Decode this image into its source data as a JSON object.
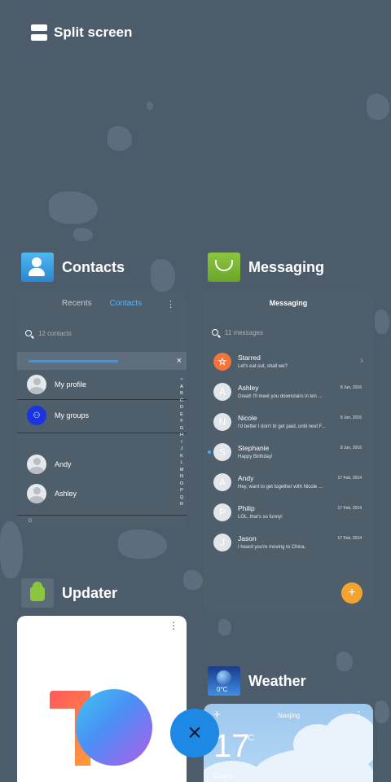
{
  "split": {
    "label": "Split screen"
  },
  "contacts": {
    "title": "Contacts",
    "tabs": [
      "Recents",
      "Contacts"
    ],
    "search_placeholder": "12 contacts",
    "rows": [
      "My profile",
      "My groups",
      "Andy",
      "Ashley"
    ],
    "section_letter": "D",
    "alphabet": [
      "♥",
      "A",
      "B",
      "C",
      "D",
      "E",
      "F",
      "G",
      "H",
      "I",
      "J",
      "K",
      "L",
      "M",
      "N",
      "O",
      "P",
      "Q",
      "R"
    ]
  },
  "messaging": {
    "title": "Messaging",
    "header": "Messaging",
    "search_placeholder": "11 messages",
    "rows": [
      {
        "initial": "☆",
        "name": "Starred",
        "preview": "Let's eat out, shall we?",
        "date": ""
      },
      {
        "initial": "A",
        "name": "Ashley",
        "preview": "Great! I'll meet you downstairs in ten ...",
        "date": "8 Jun, 2016"
      },
      {
        "initial": "N",
        "name": "Nicole",
        "preview": "I'd better I don't b! get paid, until next F...",
        "date": "8 Jun, 2016"
      },
      {
        "initial": "S",
        "name": "Stephanie",
        "preview": "Happy Birthday!",
        "date": "8 Jun, 2016"
      },
      {
        "initial": "A",
        "name": "Andy",
        "preview": "Hey, want to get together with Nicole ...",
        "date": "17 Feb, 2014"
      },
      {
        "initial": "P",
        "name": "Philip",
        "preview": "LOL, that's so funny!",
        "date": "17 Feb, 2014"
      },
      {
        "initial": "J",
        "name": "Jason",
        "preview": "I heard you're moving to China.",
        "date": "17 Feb, 2014"
      }
    ],
    "fab": "+"
  },
  "updater": {
    "title": "Updater",
    "menu": "⋮"
  },
  "weather": {
    "title": "Weather",
    "icon_temp": "0°C",
    "add": "+",
    "city": "Nanjing",
    "menu": "⋮",
    "temp": "17",
    "unit": "°C",
    "condition": "Cloudy"
  },
  "close": {
    "label": "×"
  },
  "colors": {
    "accent": "#1e88e5",
    "background": "#4d5c6a"
  }
}
